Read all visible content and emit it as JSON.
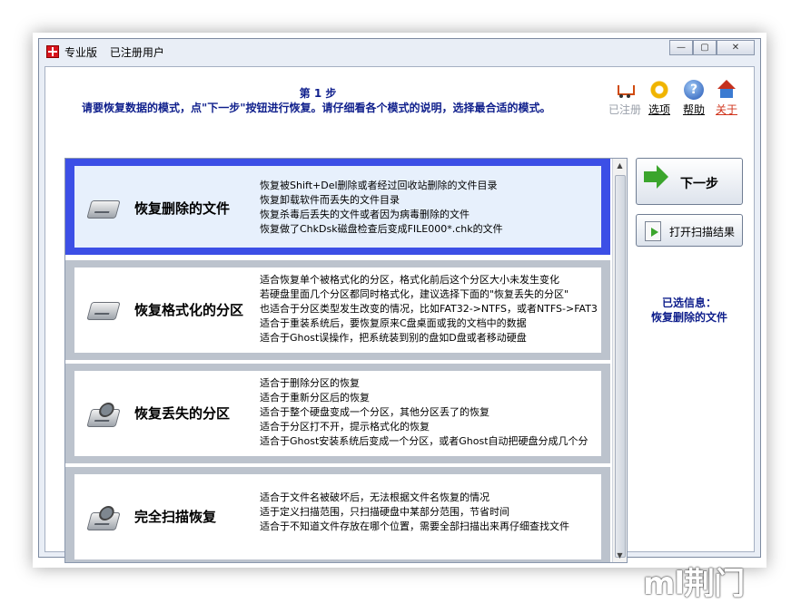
{
  "window": {
    "title_edition": "专业版",
    "title_user": "已注册用户",
    "min_glyph": "—",
    "max_glyph": "▢",
    "close_glyph": "✕"
  },
  "header": {
    "step": "第 1 步",
    "instruction": "请要恢复数据的模式，点\"下一步\"按钮进行恢复。请仔细看各个模式的说明，选择最合适的模式。"
  },
  "toolbar": [
    {
      "label": "已注册",
      "icon": "cart-icon",
      "state": "disabled"
    },
    {
      "label": "选项",
      "icon": "gear-icon",
      "state": "enabled"
    },
    {
      "label": "帮助",
      "icon": "help-icon",
      "state": "enabled"
    },
    {
      "label": "关于",
      "icon": "home-icon",
      "state": "enabled"
    }
  ],
  "modes": [
    {
      "title": "恢复删除的文件",
      "selected": true,
      "icon": "hard-disk-icon",
      "lines": [
        "恢复被Shift+Del删除或者经过回收站删除的文件目录",
        "恢复卸载软件而丢失的文件目录",
        "恢复杀毒后丢失的文件或者因为病毒删除的文件",
        "恢复做了ChkDsk磁盘检查后变成FILE000*.chk的文件"
      ]
    },
    {
      "title": "恢复格式化的分区",
      "selected": false,
      "icon": "hard-disk-icon",
      "lines": [
        "适合恢复单个被格式化的分区，格式化前后这个分区大小未发生变化",
        "若硬盘里面几个分区都同时格式化，建议选择下面的\"恢复丢失的分区\"",
        "也适合于分区类型发生改变的情况，比如FAT32->NTFS，或者NTFS->FAT3",
        "适合于重装系统后，要恢复原来C盘桌面或我的文档中的数据",
        "适合于Ghost误操作，把系统装到别的盘如D盘或者移动硬盘"
      ]
    },
    {
      "title": "恢复丢失的分区",
      "selected": false,
      "icon": "open-hard-disk-icon",
      "lines": [
        "适合于删除分区的恢复",
        "适合于重新分区后的恢复",
        "适合于整个硬盘变成一个分区，其他分区丢了的恢复",
        "适合于分区打不开，提示格式化的恢复",
        "适合于Ghost安装系统后变成一个分区，或者Ghost自动把硬盘分成几个分"
      ]
    },
    {
      "title": "完全扫描恢复",
      "selected": false,
      "icon": "open-hard-disk-icon",
      "lines": [
        "适合于文件名被破坏后，无法根据文件名恢复的情况",
        "适于定义扫描范围，只扫描硬盘中某部分范围，节省时间",
        "适合于不知道文件存放在哪个位置，需要全部扫描出来再仔细查找文件"
      ]
    }
  ],
  "actions": {
    "next_label": "下一步",
    "open_scan_label": "打开扫描结果"
  },
  "selection_info": {
    "label": "已选信息：",
    "value": "恢复删除的文件"
  },
  "scrollbar": {
    "up_glyph": "▲",
    "down_glyph": "▼"
  },
  "watermark": "ml荆门"
}
